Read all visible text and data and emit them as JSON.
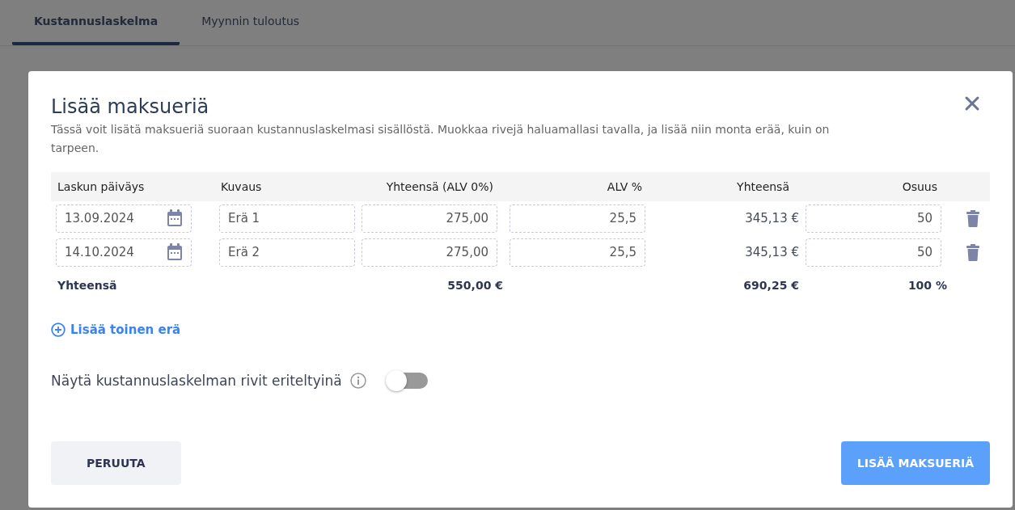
{
  "tabs": [
    {
      "label": "Kustannuslaskelma",
      "selected": true
    },
    {
      "label": "Myynnin tuloutus",
      "selected": false
    }
  ],
  "dialog": {
    "title": "Lisää maksueriä",
    "description": "Tässä voit lisätä maksueriä suoraan kustannuslaskelmasi sisällöstä. Muokkaa rivejä haluamallasi tavalla, ja lisää niin monta erää, kuin on tarpeen.",
    "table": {
      "columns": [
        "Laskun päiväys",
        "Kuvaus",
        "Yhteensä (ALV 0%)",
        "ALV %",
        "Yhteensä",
        "Osuus"
      ],
      "rows": [
        {
          "date": "13.09.2024",
          "description": "Erä 1",
          "net": "275,00",
          "vat": "25,5",
          "total": "345,13 €",
          "share": "50"
        },
        {
          "date": "14.10.2024",
          "description": "Erä 2",
          "net": "275,00",
          "vat": "25,5",
          "total": "345,13 €",
          "share": "50"
        }
      ],
      "totals": {
        "label": "Yhteensä",
        "net": "550,00 €",
        "total": "690,25 €",
        "share": "100 %"
      }
    },
    "add_link": "Lisää toinen erä",
    "toggle": {
      "label": "Näytä kustannuslaskelman rivit eriteltyinä",
      "on": false
    },
    "buttons": {
      "cancel": "PERUUTA",
      "confirm": "LISÄÄ MAKSUERIÄ"
    }
  }
}
